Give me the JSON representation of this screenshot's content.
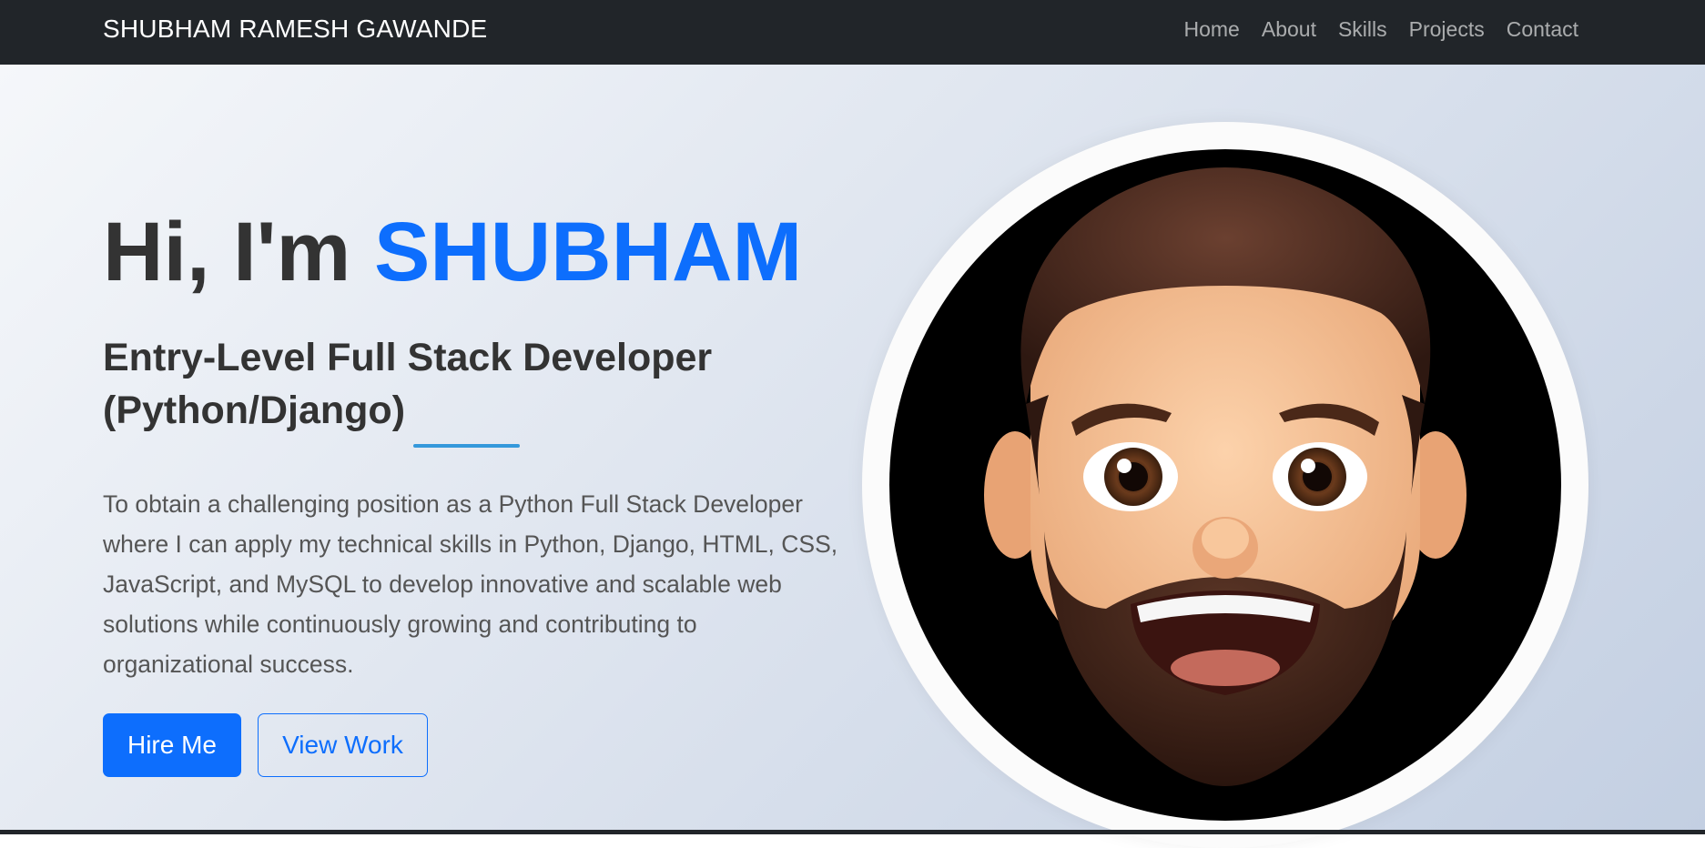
{
  "navbar": {
    "brand": "SHUBHAM RAMESH GAWANDE",
    "links": [
      {
        "label": "Home"
      },
      {
        "label": "About"
      },
      {
        "label": "Skills"
      },
      {
        "label": "Projects"
      },
      {
        "label": "Contact"
      }
    ]
  },
  "hero": {
    "greeting": "Hi, I'm",
    "name": "SHUBHAM",
    "subtitle": "Entry-Level Full Stack Developer (Python/Django)",
    "description": "To obtain a challenging position as a Python Full Stack Developer where I can apply my technical skills in Python, Django, HTML, CSS, JavaScript, and MySQL to develop innovative and scalable web solutions while continuously growing and contributing to organizational success.",
    "buttons": {
      "primary": "Hire Me",
      "secondary": "View Work"
    },
    "avatar_icon": "memoji-avatar-icon"
  },
  "colors": {
    "navbar_bg": "#212529",
    "accent": "#0d6efd",
    "divider": "#3498db",
    "heading": "#333333"
  }
}
